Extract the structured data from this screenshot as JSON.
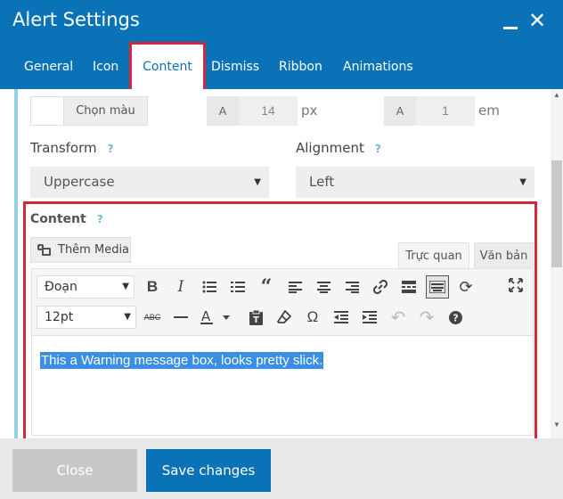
{
  "window": {
    "title": "Alert Settings"
  },
  "tabs": [
    {
      "label": "General"
    },
    {
      "label": "Icon"
    },
    {
      "label": "Content"
    },
    {
      "label": "Dismiss"
    },
    {
      "label": "Ribbon"
    },
    {
      "label": "Animations"
    }
  ],
  "active_tab": "Content",
  "font": {
    "color_button_label": "Chọn màu",
    "size_prefix": "A",
    "size_value": "14",
    "size_unit": "px",
    "line_prefix": "A",
    "line_value": "1",
    "line_unit": "em"
  },
  "transform": {
    "label": "Transform",
    "help": "?",
    "value": "Uppercase"
  },
  "alignment": {
    "label": "Alignment",
    "help": "?",
    "value": "Left"
  },
  "content": {
    "label": "Content",
    "help": "?",
    "add_media_label": "Thêm Media",
    "tab_visual": "Trực quan",
    "tab_text": "Văn bản",
    "format_select": "Đoạn",
    "font_size_select": "12pt",
    "body_text": "This a Warning message box, looks pretty slick."
  },
  "toolbar_icons": {
    "row1": [
      "bold-icon",
      "italic-icon",
      "bullet-list-icon",
      "numbered-list-icon",
      "blockquote-icon",
      "align-left-icon",
      "align-center-icon",
      "align-right-icon",
      "link-icon",
      "read-more-icon",
      "keyboard-toggle-icon",
      "refresh-icon",
      "fullscreen-icon"
    ],
    "row2": [
      "strikethrough-icon",
      "horizontal-line-icon",
      "text-color-icon",
      "paste-text-icon",
      "clear-format-icon",
      "omega-icon",
      "outdent-icon",
      "indent-icon",
      "undo-icon",
      "redo-icon",
      "help-icon"
    ]
  },
  "footer": {
    "close_label": "Close",
    "save_label": "Save changes"
  },
  "colors": {
    "header": "#0a73b8",
    "highlight_outline": "#d3283a",
    "accent_rule": "#8fd1dc",
    "selection": "#3a8ee6",
    "close_button": "#c8c8c8"
  }
}
